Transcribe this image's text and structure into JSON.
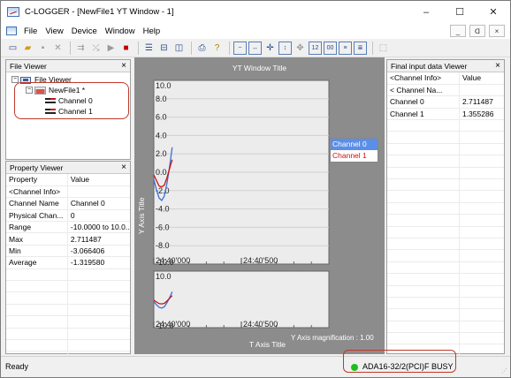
{
  "window": {
    "title": "C-LOGGER - [NewFile1 YT Window - 1]",
    "minimize": "–",
    "maximize": "☐",
    "close": "✕"
  },
  "menu": {
    "items": [
      "File",
      "View",
      "Device",
      "Window",
      "Help"
    ],
    "mdi_minimize": "_",
    "mdi_restore": "ᗡ",
    "mdi_close": "×"
  },
  "file_viewer": {
    "title": "File Viewer",
    "close": "×",
    "root": "File Viewer",
    "file": "NewFile1 *",
    "channels": [
      "Channel 0",
      "Channel 1"
    ]
  },
  "property_viewer": {
    "title": "Property Viewer",
    "close": "×",
    "rows": [
      [
        "Property",
        "Value"
      ],
      [
        "<Channel Info>",
        ""
      ],
      [
        "Channel Name",
        "Channel 0"
      ],
      [
        "Physical Chan...",
        "0"
      ],
      [
        "Range",
        "-10.0000 to 10.0..."
      ],
      [
        "Max",
        "2.711487"
      ],
      [
        "Min",
        "-3.066406"
      ],
      [
        "Average",
        "-1.319580"
      ],
      [
        "",
        ""
      ],
      [
        "",
        ""
      ],
      [
        "",
        ""
      ],
      [
        "",
        ""
      ],
      [
        "",
        ""
      ],
      [
        "",
        ""
      ],
      [
        "",
        ""
      ],
      [
        "",
        ""
      ]
    ]
  },
  "final_input": {
    "title": "Final input data Viewer",
    "close": "×",
    "rows": [
      [
        "<Channel Info>",
        "Value"
      ],
      [
        "< Channel Na...",
        ""
      ],
      [
        "Channel 0",
        "2.711487"
      ],
      [
        "Channel 1",
        "1.355286"
      ],
      [
        "",
        ""
      ],
      [
        "",
        ""
      ],
      [
        "",
        ""
      ],
      [
        "",
        ""
      ],
      [
        "",
        ""
      ],
      [
        "",
        ""
      ],
      [
        "",
        ""
      ],
      [
        "",
        ""
      ],
      [
        "",
        ""
      ],
      [
        "",
        ""
      ],
      [
        "",
        ""
      ],
      [
        "",
        ""
      ],
      [
        "",
        ""
      ],
      [
        "",
        ""
      ],
      [
        "",
        ""
      ],
      [
        "",
        ""
      ],
      [
        "",
        ""
      ],
      [
        "",
        ""
      ],
      [
        "",
        ""
      ],
      [
        "",
        ""
      ]
    ]
  },
  "graph": {
    "title": "YT Window Title",
    "y_axis_title": "Y Axis Title",
    "x_axis_title": "T Axis Title",
    "magnification": "Y Axis magnification : 1.00",
    "legend": [
      "Channel 0",
      "Channel 1"
    ]
  },
  "chart_data": [
    {
      "type": "line",
      "title": "YT Window Title",
      "xlabel": "T Axis Title",
      "ylabel": "Y Axis Title",
      "ylim": [
        -10.0,
        10.0
      ],
      "y_ticks": [
        "10.0",
        "8.0",
        "6.0",
        "4.0",
        "2.0",
        "0.0",
        "-2.0",
        "-4.0",
        "-6.0",
        "-8.0",
        "-10.0"
      ],
      "x_ticks": [
        "24:40'000",
        "24:40'500"
      ],
      "series": [
        {
          "name": "Channel 0",
          "color": "#3a6fd8",
          "x": [
            0,
            0.05,
            0.1,
            0.15,
            0.2,
            0.25,
            0.3,
            0.35
          ],
          "values": [
            -0.8,
            -1.9,
            -2.8,
            -3.07,
            -2.6,
            -1.2,
            0.6,
            2.71
          ]
        },
        {
          "name": "Channel 1",
          "color": "#d01010",
          "x": [
            0,
            0.05,
            0.1,
            0.15,
            0.2,
            0.25,
            0.3,
            0.35
          ],
          "values": [
            -0.3,
            -0.9,
            -1.5,
            -1.6,
            -1.4,
            -0.6,
            0.4,
            1.36
          ]
        }
      ]
    },
    {
      "type": "line",
      "ylim": [
        -10.0,
        10.0
      ],
      "y_ticks": [
        "10.0",
        "-10.0"
      ],
      "x_ticks": [
        "24:40'000",
        "24:40'500"
      ],
      "series": [
        {
          "name": "Channel 0",
          "color": "#3a6fd8",
          "x": [
            0,
            0.05,
            0.1,
            0.15,
            0.2,
            0.25,
            0.3,
            0.35
          ],
          "values": [
            -0.8,
            -1.9,
            -2.8,
            -3.07,
            -2.6,
            -1.2,
            0.6,
            2.71
          ]
        },
        {
          "name": "Channel 1",
          "color": "#d01010",
          "x": [
            0,
            0.05,
            0.1,
            0.15,
            0.2,
            0.25,
            0.3,
            0.35
          ],
          "values": [
            -0.3,
            -0.9,
            -1.5,
            -1.6,
            -1.4,
            -0.6,
            0.4,
            1.36
          ]
        }
      ]
    }
  ],
  "status": {
    "left": "Ready",
    "device": "ADA16-32/2(PCI)F BUSY",
    "indicator_color": "#19c219"
  }
}
